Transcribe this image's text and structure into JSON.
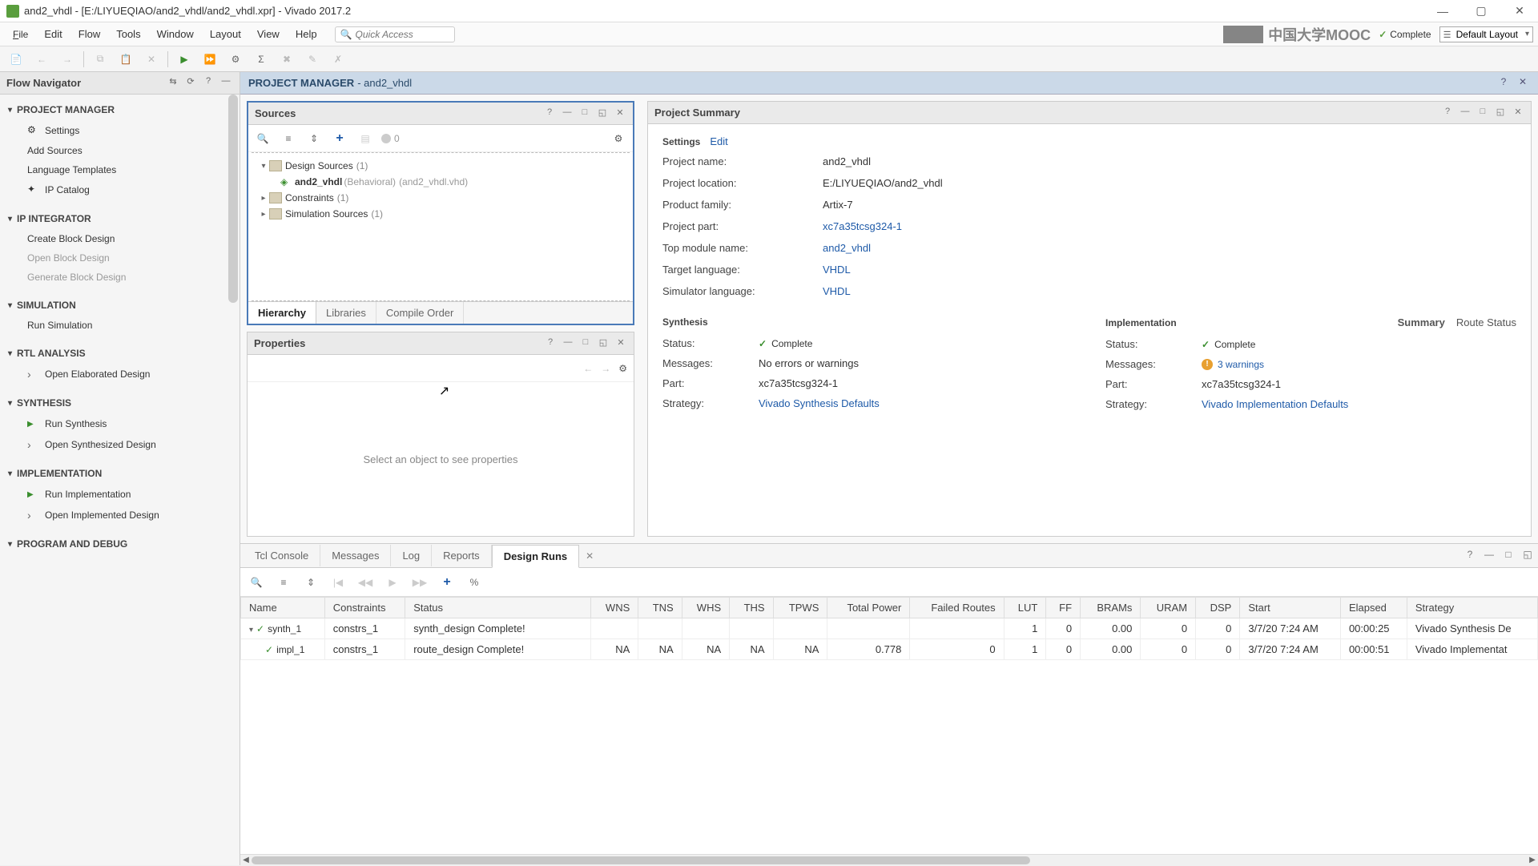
{
  "window": {
    "title": "and2_vhdl - [E:/LIYUEQIAO/and2_vhdl/and2_vhdl.xpr] - Vivado 2017.2"
  },
  "menu": {
    "file": "File",
    "edit": "Edit",
    "flow": "Flow",
    "tools": "Tools",
    "window": "Window",
    "layout": "Layout",
    "view": "View",
    "help": "Help",
    "quick_access_placeholder": "Quick Access",
    "status_label": "Complete",
    "layout_selector": "Default Layout",
    "watermark_text": "中国大学MOOC"
  },
  "flow_nav": {
    "title": "Flow Navigator",
    "sections": {
      "project_manager": "PROJECT MANAGER",
      "settings": "Settings",
      "add_sources": "Add Sources",
      "language_templates": "Language Templates",
      "ip_catalog": "IP Catalog",
      "ip_integrator": "IP INTEGRATOR",
      "create_block": "Create Block Design",
      "open_block": "Open Block Design",
      "generate_block": "Generate Block Design",
      "simulation": "SIMULATION",
      "run_simulation": "Run Simulation",
      "rtl_analysis": "RTL ANALYSIS",
      "open_elaborated": "Open Elaborated Design",
      "synthesis": "SYNTHESIS",
      "run_synthesis": "Run Synthesis",
      "open_synthesized": "Open Synthesized Design",
      "implementation": "IMPLEMENTATION",
      "run_implementation": "Run Implementation",
      "open_implemented": "Open Implemented Design",
      "program_debug": "PROGRAM AND DEBUG"
    }
  },
  "pm_header": {
    "title": "PROJECT MANAGER",
    "sub": " - and2_vhdl"
  },
  "sources": {
    "title": "Sources",
    "badge_count": "0",
    "tree": {
      "design_sources": "Design Sources",
      "design_sources_count": "(1)",
      "top_module": "and2_vhdl",
      "top_module_behav": "(Behavioral)",
      "top_module_file": "(and2_vhdl.vhd)",
      "constraints": "Constraints",
      "constraints_count": "(1)",
      "sim_sources": "Simulation Sources",
      "sim_sources_count": "(1)"
    },
    "tabs": {
      "hierarchy": "Hierarchy",
      "libraries": "Libraries",
      "compile_order": "Compile Order"
    }
  },
  "properties": {
    "title": "Properties",
    "empty_msg": "Select an object to see properties"
  },
  "summary": {
    "title": "Project Summary",
    "settings_title": "Settings",
    "edit_link": "Edit",
    "rows": {
      "project_name_l": "Project name:",
      "project_name_v": "and2_vhdl",
      "project_loc_l": "Project location:",
      "project_loc_v": "E:/LIYUEQIAO/and2_vhdl",
      "product_family_l": "Product family:",
      "product_family_v": "Artix-7",
      "project_part_l": "Project part:",
      "project_part_v": "xc7a35tcsg324-1",
      "top_module_l": "Top module name:",
      "top_module_v": "and2_vhdl",
      "target_lang_l": "Target language:",
      "target_lang_v": "VHDL",
      "sim_lang_l": "Simulator language:",
      "sim_lang_v": "VHDL"
    },
    "synth": {
      "title": "Synthesis",
      "status_l": "Status:",
      "status_v": "Complete",
      "messages_l": "Messages:",
      "messages_v": "No errors or warnings",
      "part_l": "Part:",
      "part_v": "xc7a35tcsg324-1",
      "strategy_l": "Strategy:",
      "strategy_v": "Vivado Synthesis Defaults"
    },
    "impl": {
      "title": "Implementation",
      "tab_summary": "Summary",
      "tab_route": "Route Status",
      "status_l": "Status:",
      "status_v": "Complete",
      "messages_l": "Messages:",
      "messages_v": "3 warnings",
      "part_l": "Part:",
      "part_v": "xc7a35tcsg324-1",
      "strategy_l": "Strategy:",
      "strategy_v": "Vivado Implementation Defaults"
    }
  },
  "bottom": {
    "tabs": {
      "tcl": "Tcl Console",
      "messages": "Messages",
      "log": "Log",
      "reports": "Reports",
      "design_runs": "Design Runs"
    },
    "columns": {
      "name": "Name",
      "constraints": "Constraints",
      "status": "Status",
      "wns": "WNS",
      "tns": "TNS",
      "whs": "WHS",
      "ths": "THS",
      "tpws": "TPWS",
      "total_power": "Total Power",
      "failed_routes": "Failed Routes",
      "lut": "LUT",
      "ff": "FF",
      "brams": "BRAMs",
      "uram": "URAM",
      "dsp": "DSP",
      "start": "Start",
      "elapsed": "Elapsed",
      "strategy": "Strategy"
    },
    "rows": [
      {
        "name": "synth_1",
        "constraints": "constrs_1",
        "status": "synth_design Complete!",
        "wns": "",
        "tns": "",
        "whs": "",
        "ths": "",
        "tpws": "",
        "total_power": "",
        "failed_routes": "",
        "lut": "1",
        "ff": "0",
        "brams": "0.00",
        "uram": "0",
        "dsp": "0",
        "start": "3/7/20 7:24 AM",
        "elapsed": "00:00:25",
        "strategy": "Vivado Synthesis De"
      },
      {
        "name": "impl_1",
        "constraints": "constrs_1",
        "status": "route_design Complete!",
        "wns": "NA",
        "tns": "NA",
        "whs": "NA",
        "ths": "NA",
        "tpws": "NA",
        "total_power": "0.778",
        "failed_routes": "0",
        "lut": "1",
        "ff": "0",
        "brams": "0.00",
        "uram": "0",
        "dsp": "0",
        "start": "3/7/20 7:24 AM",
        "elapsed": "00:00:51",
        "strategy": "Vivado Implementat"
      }
    ]
  }
}
